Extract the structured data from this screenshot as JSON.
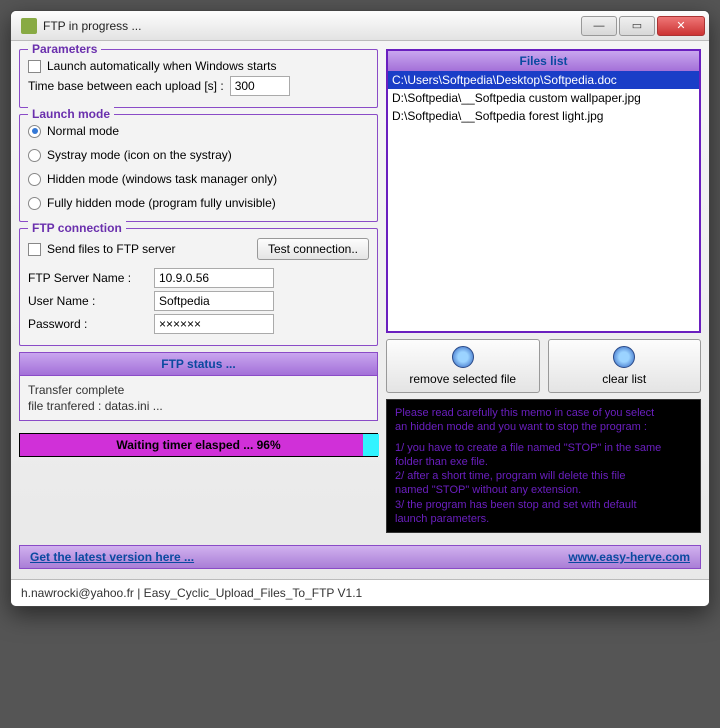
{
  "window": {
    "title": "FTP in progress ..."
  },
  "parameters": {
    "legend": "Parameters",
    "launch_auto_label": "Launch automatically when Windows starts",
    "timebase_label": "Time base between each upload [s] :",
    "timebase_value": "300"
  },
  "launch_mode": {
    "legend": "Launch mode",
    "options": [
      "Normal mode",
      "Systray mode (icon on the systray)",
      "Hidden mode (windows task manager only)",
      "Fully hidden mode (program fully unvisible)"
    ],
    "selected": 0
  },
  "ftp": {
    "legend": "FTP connection",
    "send_label": "Send files to FTP server",
    "test_btn": "Test connection..",
    "server_label": "FTP Server Name :",
    "server_value": "10.9.0.56",
    "user_label": "User Name :",
    "user_value": "Softpedia",
    "pass_label": "Password :",
    "pass_value": "××××××"
  },
  "status": {
    "header": "FTP status ...",
    "line1": "Transfer complete",
    "line2": "file tranfered : datas.ini ...",
    "progress_label": "Waiting timer elasped ... 96%",
    "progress_pct": 96
  },
  "files": {
    "header": "Files list",
    "items": [
      "C:\\Users\\Softpedia\\Desktop\\Softpedia.doc",
      "D:\\Softpedia\\__Softpedia custom wallpaper.jpg",
      "D:\\Softpedia\\__Softpedia forest light.jpg"
    ],
    "selected": 0,
    "remove_btn": "remove selected file",
    "clear_btn": "clear list"
  },
  "memo": {
    "l1": "Please read carefully this memo in case of you select",
    "l2": "an hidden mode and you want to stop the program :",
    "l3": "1/ you have to create a file named \"STOP\" in the same",
    "l4": "folder than exe file.",
    "l5": "2/ after a short time, program will delete this file",
    "l6": "named \"STOP\" without any extension.",
    "l7": "3/ the program has been stop and set with default",
    "l8": "launch parameters."
  },
  "links": {
    "left": "Get the latest version here ...",
    "right": "www.easy-herve.com"
  },
  "statusbar": "h.nawrocki@yahoo.fr  |  Easy_Cyclic_Upload_Files_To_FTP V1.1"
}
